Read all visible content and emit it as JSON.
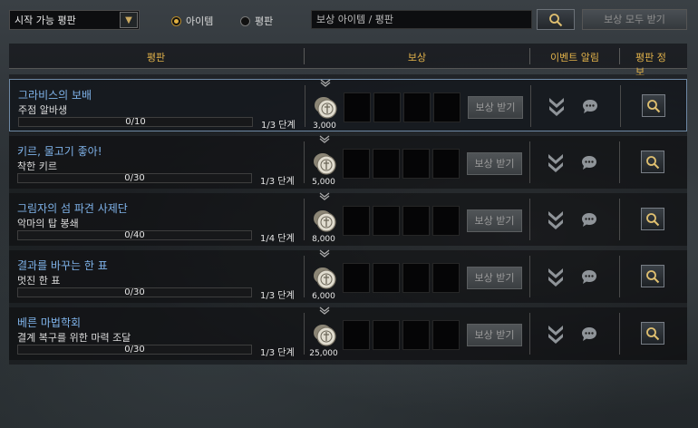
{
  "filter": {
    "dropdown_value": "시작 가능 평판",
    "dropdown_arrow": "chevron-down-icon"
  },
  "radios": [
    {
      "label": "아이템",
      "selected": true
    },
    {
      "label": "평판",
      "selected": false
    }
  ],
  "search": {
    "placeholder": "보상 아이템 / 평판"
  },
  "claim_all_label": "보상 모두 받기",
  "columns": {
    "reputation": "평판",
    "reward": "보상",
    "event_alert": "이벤트 알림",
    "reputation_info": "평판 정보"
  },
  "rows": [
    {
      "name": "그라비스의 보배",
      "task": "주점 알바생",
      "progress_text": "0/10",
      "stage": "1/3 단계",
      "reward_amount": "3,000",
      "claim_label": "보상 받기",
      "selected": true
    },
    {
      "name": "키르, 물고기 좋아!",
      "task": "착한 키르",
      "progress_text": "0/30",
      "stage": "1/3 단계",
      "reward_amount": "5,000",
      "claim_label": "보상 받기",
      "selected": false
    },
    {
      "name": "그림자의 섬 파견 사제단",
      "task": "악마의 탑 봉쇄",
      "progress_text": "0/40",
      "stage": "1/4 단계",
      "reward_amount": "8,000",
      "claim_label": "보상 받기",
      "selected": false
    },
    {
      "name": "결과를 바꾸는 한 표",
      "task": "멋진 한 표",
      "progress_text": "0/30",
      "stage": "1/3 단계",
      "reward_amount": "6,000",
      "claim_label": "보상 받기",
      "selected": false
    },
    {
      "name": "베른 마법학회",
      "task": "결계 복구를 위한 마력 조달",
      "progress_text": "0/30",
      "stage": "1/3 단계",
      "reward_amount": "25,000",
      "claim_label": "보상 받기",
      "selected": false
    }
  ],
  "colors": {
    "accent_gold": "#e2b24a",
    "name_blue": "#7fb3ea",
    "selected_border": "#6d88a4"
  }
}
